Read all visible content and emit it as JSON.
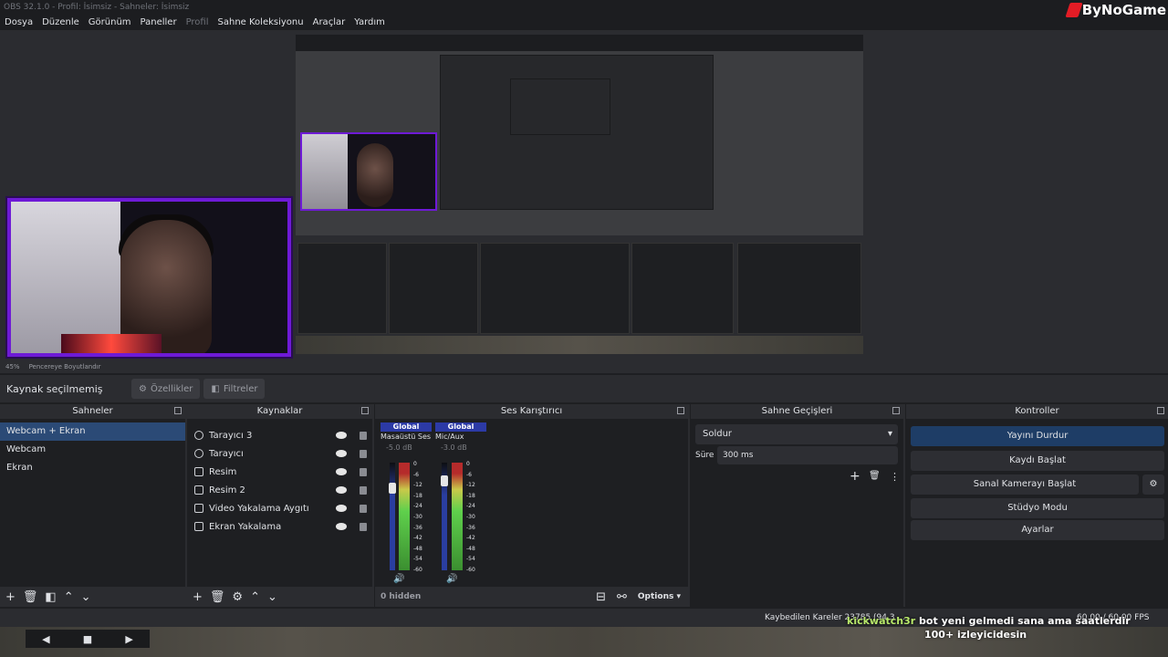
{
  "window": {
    "title": "OBS 32.1.0 - Profil: İsimsiz - Sahneler: İsimsiz",
    "brand": "ByNoGame"
  },
  "menu": [
    "Dosya",
    "Düzenle",
    "Görünüm",
    "Paneller",
    "Profil",
    "Sahne Koleksiyonu",
    "Araçlar",
    "Yardım"
  ],
  "zoombar": {
    "zoom": "45%",
    "fit": "Pencereye Boyutlandır"
  },
  "context": {
    "no_source": "Kaynak seçilmemiş",
    "properties": "Özellikler",
    "filters": "Filtreler"
  },
  "docks": {
    "scenes": {
      "title": "Sahneler",
      "items": [
        "Webcam + Ekran",
        "Webcam",
        "Ekran"
      ],
      "selected": 0
    },
    "sources": {
      "title": "Kaynaklar",
      "items": [
        {
          "name": "Tarayıcı 3",
          "icon": "globe-icon"
        },
        {
          "name": "Tarayıcı",
          "icon": "globe-icon"
        },
        {
          "name": "Resim",
          "icon": "image-icon"
        },
        {
          "name": "Resim 2",
          "icon": "image-icon"
        },
        {
          "name": "Video Yakalama Aygıtı",
          "icon": "camera-icon"
        },
        {
          "name": "Ekran Yakalama",
          "icon": "monitor-icon"
        }
      ]
    },
    "mixer": {
      "title": "Ses Karıştırıcı",
      "channels": [
        {
          "tag": "Global",
          "name": "Masaüstü Ses",
          "db": "-5.0 dB"
        },
        {
          "tag": "Global",
          "name": "Mic/Aux",
          "db": "-3.0 dB"
        }
      ],
      "ticks": [
        "0",
        "-6",
        "-12",
        "-18",
        "-24",
        "-30",
        "-36",
        "-42",
        "-48",
        "-54",
        "-60"
      ],
      "hidden": "0 hidden",
      "options": "Options"
    },
    "transitions": {
      "title": "Sahne Geçişleri",
      "selected": "Soldur",
      "duration_label": "Süre",
      "duration": "300 ms"
    },
    "controls": {
      "title": "Kontroller",
      "stream": "Yayını Durdur",
      "record": "Kaydı Başlat",
      "virtualcam": "Sanal Kamerayı Başlat",
      "studio": "Stüdyo Modu",
      "settings": "Ayarlar"
    }
  },
  "status": {
    "dropped": "Kaybedilen Kareler 23785 (94.3 ...",
    "fps": "60.00 / 60.00 FPS"
  },
  "chat": {
    "user": "kickwatch3r",
    "message": "bot yeni gelmedi sana ama saatlerdir",
    "message2": "100+ izleyicidesin"
  },
  "colors": {
    "accent": "#2b4a76",
    "meter_green": "#5fd04c",
    "purple": "#6e1ad6",
    "brand_red": "#e31c25"
  }
}
